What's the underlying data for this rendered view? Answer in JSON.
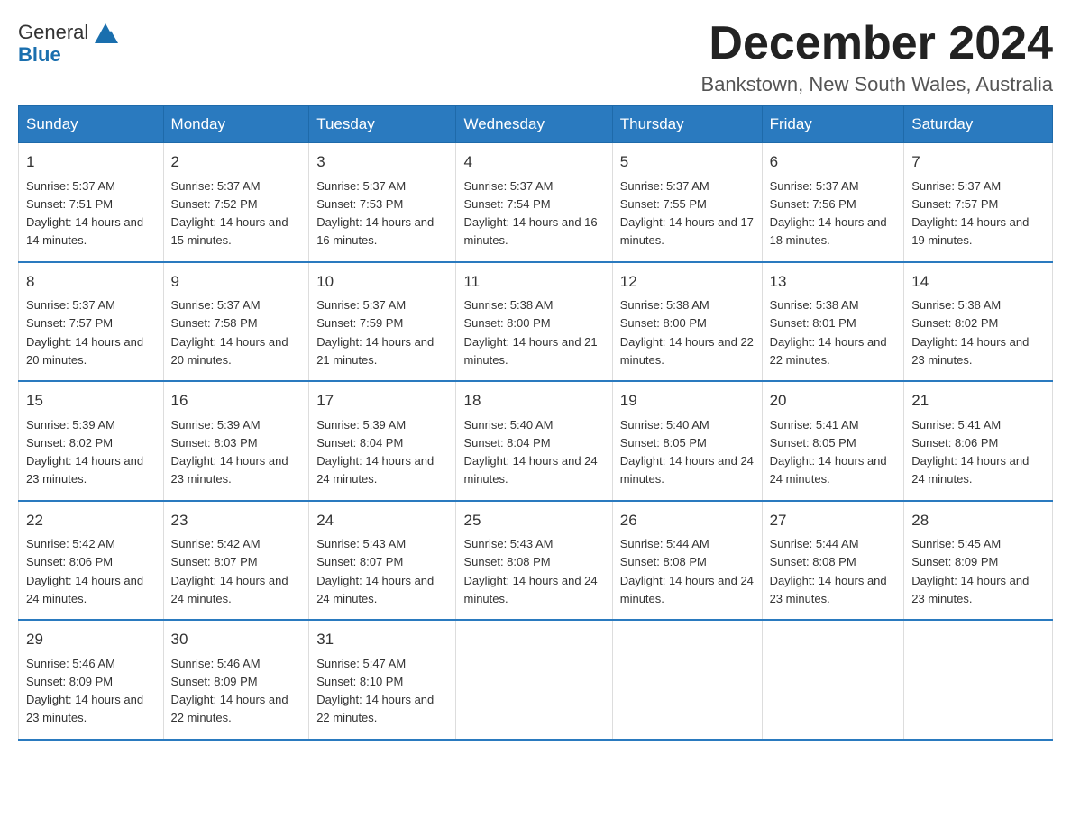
{
  "logo": {
    "text_general": "General",
    "text_blue": "Blue"
  },
  "title": "December 2024",
  "location": "Bankstown, New South Wales, Australia",
  "weekdays": [
    "Sunday",
    "Monday",
    "Tuesday",
    "Wednesday",
    "Thursday",
    "Friday",
    "Saturday"
  ],
  "weeks": [
    [
      {
        "day": "1",
        "sunrise": "5:37 AM",
        "sunset": "7:51 PM",
        "daylight": "14 hours and 14 minutes."
      },
      {
        "day": "2",
        "sunrise": "5:37 AM",
        "sunset": "7:52 PM",
        "daylight": "14 hours and 15 minutes."
      },
      {
        "day": "3",
        "sunrise": "5:37 AM",
        "sunset": "7:53 PM",
        "daylight": "14 hours and 16 minutes."
      },
      {
        "day": "4",
        "sunrise": "5:37 AM",
        "sunset": "7:54 PM",
        "daylight": "14 hours and 16 minutes."
      },
      {
        "day": "5",
        "sunrise": "5:37 AM",
        "sunset": "7:55 PM",
        "daylight": "14 hours and 17 minutes."
      },
      {
        "day": "6",
        "sunrise": "5:37 AM",
        "sunset": "7:56 PM",
        "daylight": "14 hours and 18 minutes."
      },
      {
        "day": "7",
        "sunrise": "5:37 AM",
        "sunset": "7:57 PM",
        "daylight": "14 hours and 19 minutes."
      }
    ],
    [
      {
        "day": "8",
        "sunrise": "5:37 AM",
        "sunset": "7:57 PM",
        "daylight": "14 hours and 20 minutes."
      },
      {
        "day": "9",
        "sunrise": "5:37 AM",
        "sunset": "7:58 PM",
        "daylight": "14 hours and 20 minutes."
      },
      {
        "day": "10",
        "sunrise": "5:37 AM",
        "sunset": "7:59 PM",
        "daylight": "14 hours and 21 minutes."
      },
      {
        "day": "11",
        "sunrise": "5:38 AM",
        "sunset": "8:00 PM",
        "daylight": "14 hours and 21 minutes."
      },
      {
        "day": "12",
        "sunrise": "5:38 AM",
        "sunset": "8:00 PM",
        "daylight": "14 hours and 22 minutes."
      },
      {
        "day": "13",
        "sunrise": "5:38 AM",
        "sunset": "8:01 PM",
        "daylight": "14 hours and 22 minutes."
      },
      {
        "day": "14",
        "sunrise": "5:38 AM",
        "sunset": "8:02 PM",
        "daylight": "14 hours and 23 minutes."
      }
    ],
    [
      {
        "day": "15",
        "sunrise": "5:39 AM",
        "sunset": "8:02 PM",
        "daylight": "14 hours and 23 minutes."
      },
      {
        "day": "16",
        "sunrise": "5:39 AM",
        "sunset": "8:03 PM",
        "daylight": "14 hours and 23 minutes."
      },
      {
        "day": "17",
        "sunrise": "5:39 AM",
        "sunset": "8:04 PM",
        "daylight": "14 hours and 24 minutes."
      },
      {
        "day": "18",
        "sunrise": "5:40 AM",
        "sunset": "8:04 PM",
        "daylight": "14 hours and 24 minutes."
      },
      {
        "day": "19",
        "sunrise": "5:40 AM",
        "sunset": "8:05 PM",
        "daylight": "14 hours and 24 minutes."
      },
      {
        "day": "20",
        "sunrise": "5:41 AM",
        "sunset": "8:05 PM",
        "daylight": "14 hours and 24 minutes."
      },
      {
        "day": "21",
        "sunrise": "5:41 AM",
        "sunset": "8:06 PM",
        "daylight": "14 hours and 24 minutes."
      }
    ],
    [
      {
        "day": "22",
        "sunrise": "5:42 AM",
        "sunset": "8:06 PM",
        "daylight": "14 hours and 24 minutes."
      },
      {
        "day": "23",
        "sunrise": "5:42 AM",
        "sunset": "8:07 PM",
        "daylight": "14 hours and 24 minutes."
      },
      {
        "day": "24",
        "sunrise": "5:43 AM",
        "sunset": "8:07 PM",
        "daylight": "14 hours and 24 minutes."
      },
      {
        "day": "25",
        "sunrise": "5:43 AM",
        "sunset": "8:08 PM",
        "daylight": "14 hours and 24 minutes."
      },
      {
        "day": "26",
        "sunrise": "5:44 AM",
        "sunset": "8:08 PM",
        "daylight": "14 hours and 24 minutes."
      },
      {
        "day": "27",
        "sunrise": "5:44 AM",
        "sunset": "8:08 PM",
        "daylight": "14 hours and 23 minutes."
      },
      {
        "day": "28",
        "sunrise": "5:45 AM",
        "sunset": "8:09 PM",
        "daylight": "14 hours and 23 minutes."
      }
    ],
    [
      {
        "day": "29",
        "sunrise": "5:46 AM",
        "sunset": "8:09 PM",
        "daylight": "14 hours and 23 minutes."
      },
      {
        "day": "30",
        "sunrise": "5:46 AM",
        "sunset": "8:09 PM",
        "daylight": "14 hours and 22 minutes."
      },
      {
        "day": "31",
        "sunrise": "5:47 AM",
        "sunset": "8:10 PM",
        "daylight": "14 hours and 22 minutes."
      },
      null,
      null,
      null,
      null
    ]
  ]
}
